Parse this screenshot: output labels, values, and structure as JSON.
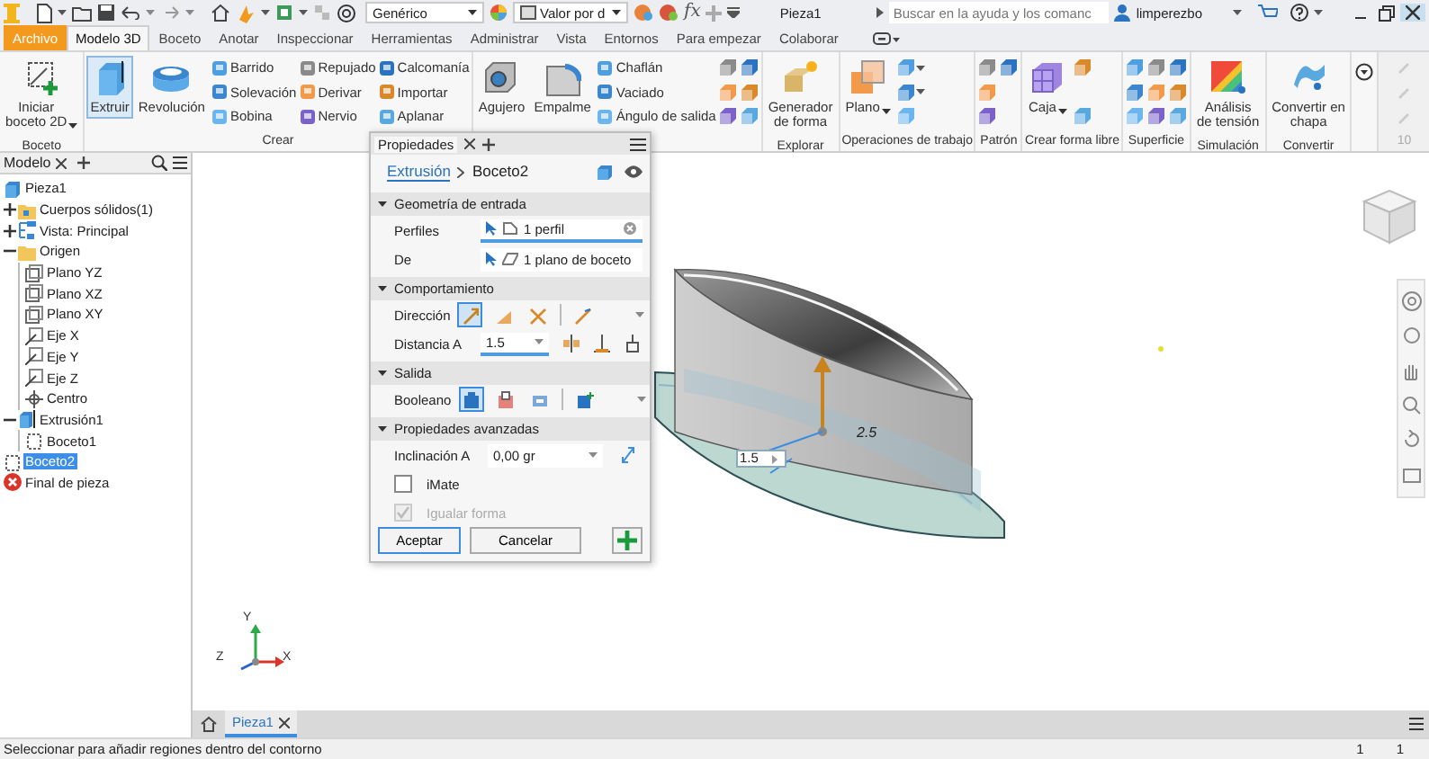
{
  "title_bar": {
    "material": "Genérico",
    "appearance": "Valor por d",
    "formula": "fx",
    "title": "Pieza1",
    "search": {
      "placeholder": "Buscar en la ayuda y los comanc"
    },
    "user": "limperezbo"
  },
  "ribbon_tabs": [
    {
      "label": "Archivo",
      "kind": "file",
      "selected": false
    },
    {
      "label": "Modelo 3D",
      "kind": "tab",
      "selected": true
    },
    {
      "label": "Boceto",
      "kind": "tab",
      "selected": false
    },
    {
      "label": "Anotar",
      "kind": "tab",
      "selected": false
    },
    {
      "label": "Inspeccionar",
      "kind": "tab",
      "selected": false
    },
    {
      "label": "Herramientas",
      "kind": "tab",
      "selected": false
    },
    {
      "label": "Administrar",
      "kind": "tab",
      "selected": false
    },
    {
      "label": "Vista",
      "kind": "tab",
      "selected": false
    },
    {
      "label": "Entornos",
      "kind": "tab",
      "selected": false
    },
    {
      "label": "Para empezar",
      "kind": "tab",
      "selected": false
    },
    {
      "label": "Colaborar",
      "kind": "tab",
      "selected": false
    }
  ],
  "ribbon_groups": [
    {
      "label": "Boceto",
      "columns": [
        [
          {
            "kind": "large",
            "label": "Iniciar\nboceto 2D",
            "dropdown": true,
            "selected": false
          }
        ]
      ]
    },
    {
      "label": "Crear",
      "columns": [
        [
          {
            "kind": "large",
            "label": "Extruir",
            "dropdown": false,
            "selected": true
          }
        ],
        [
          {
            "kind": "large",
            "label": "Revolución",
            "dropdown": false,
            "selected": false
          }
        ],
        [
          {
            "kind": "small",
            "label": "Barrido"
          },
          {
            "kind": "small",
            "label": "Solevación"
          },
          {
            "kind": "small",
            "label": "Bobina"
          }
        ],
        [
          {
            "kind": "small",
            "label": "Repujado"
          },
          {
            "kind": "small",
            "label": "Derivar"
          },
          {
            "kind": "small",
            "label": "Nervio"
          }
        ],
        [
          {
            "kind": "small",
            "label": "Calcomanía"
          },
          {
            "kind": "small",
            "label": "Importar"
          },
          {
            "kind": "small",
            "label": "Aplanar"
          }
        ]
      ]
    },
    {
      "columns": [
        [
          {
            "kind": "large",
            "label": "Agujero",
            "dropdown": false,
            "selected": false
          }
        ],
        [
          {
            "kind": "large",
            "label": "Empalme",
            "dropdown": false,
            "selected": false
          }
        ],
        [
          {
            "kind": "small",
            "label": "Chaflán"
          },
          {
            "kind": "small",
            "label": "Vaciado"
          },
          {
            "kind": "small",
            "label": "Ángulo de salida"
          }
        ],
        [
          {
            "kind": "icon",
            "dropdown": false
          },
          {
            "kind": "icon",
            "dropdown": false
          },
          {
            "kind": "icon",
            "dropdown": false
          }
        ],
        [
          {
            "kind": "icon",
            "dropdown": false
          },
          {
            "kind": "icon",
            "dropdown": false
          },
          {
            "kind": "icon",
            "dropdown": false
          }
        ]
      ]
    },
    {
      "label": "Explorar",
      "columns": [
        [
          {
            "kind": "large",
            "label": "Generador\nde forma",
            "dropdown": false,
            "selected": false
          }
        ]
      ]
    },
    {
      "label": "Operaciones de trabajo",
      "columns": [
        [
          {
            "kind": "large",
            "label": "Plano",
            "dropdown": true,
            "selected": false
          }
        ],
        [
          {
            "kind": "icon",
            "dropdown": true
          },
          {
            "kind": "icon",
            "dropdown": true
          },
          {
            "kind": "icon",
            "dropdown": false
          }
        ]
      ]
    },
    {
      "label": "Patrón",
      "columns": [
        [
          {
            "kind": "icon",
            "dropdown": false
          },
          {
            "kind": "icon",
            "dropdown": false
          },
          {
            "kind": "icon",
            "dropdown": false
          }
        ],
        [
          {
            "kind": "icon",
            "dropdown": false
          }
        ]
      ]
    },
    {
      "label": "Crear forma libre",
      "columns": [
        [
          {
            "kind": "large",
            "label": "Caja",
            "dropdown": true,
            "selected": false
          }
        ],
        [
          {
            "kind": "icon",
            "dropdown": false
          },
          {
            "kind": "icon",
            "dropdown": false
          }
        ]
      ]
    },
    {
      "label": "Superficie",
      "columns": [
        [
          {
            "kind": "icon",
            "dropdown": false
          },
          {
            "kind": "icon",
            "dropdown": false
          },
          {
            "kind": "icon",
            "dropdown": false
          }
        ],
        [
          {
            "kind": "icon",
            "dropdown": false
          },
          {
            "kind": "icon",
            "dropdown": false
          },
          {
            "kind": "icon",
            "dropdown": false
          }
        ],
        [
          {
            "kind": "icon",
            "dropdown": false
          },
          {
            "kind": "icon",
            "dropdown": false
          },
          {
            "kind": "icon",
            "dropdown": false
          }
        ]
      ]
    },
    {
      "label": "Simulación",
      "columns": [
        [
          {
            "kind": "large",
            "label": "Análisis\nde tensión",
            "dropdown": false,
            "selected": false
          }
        ]
      ]
    },
    {
      "label": "Convertir",
      "columns": [
        [
          {
            "kind": "large",
            "label": "Convertir en\nchapa",
            "dropdown": false,
            "selected": false
          }
        ]
      ]
    }
  ],
  "side_spinner": "10",
  "browser": {
    "tab": "Modelo",
    "tree": [
      {
        "label": "Pieza1",
        "kind": "part",
        "selected": false,
        "children": [
          {
            "label": "Cuerpos sólidos(1)",
            "kind": "bodies",
            "selected": false,
            "expanded": false
          },
          {
            "label": "Vista: Principal",
            "kind": "view",
            "selected": false,
            "expanded": false
          },
          {
            "label": "Origen",
            "kind": "folder",
            "selected": false,
            "expanded": true,
            "children": [
              {
                "label": "Plano YZ",
                "kind": "plane",
                "selected": false
              },
              {
                "label": "Plano XZ",
                "kind": "plane",
                "selected": false
              },
              {
                "label": "Plano XY",
                "kind": "plane",
                "selected": false
              },
              {
                "label": "Eje X",
                "kind": "axis",
                "selected": false
              },
              {
                "label": "Eje Y",
                "kind": "axis",
                "selected": false
              },
              {
                "label": "Eje Z",
                "kind": "axis",
                "selected": false
              },
              {
                "label": "Centro",
                "kind": "point",
                "selected": false
              }
            ]
          },
          {
            "label": "Extrusión1",
            "kind": "extrusion",
            "selected": false,
            "expanded": true,
            "children": [
              {
                "label": "Boceto1",
                "kind": "sketch",
                "selected": false
              }
            ]
          },
          {
            "label": "Boceto2",
            "kind": "sketch",
            "selected": true
          },
          {
            "label": "Final de pieza",
            "kind": "end",
            "selected": false
          }
        ]
      }
    ]
  },
  "properties": {
    "tab": "Propiedades",
    "breadcrumb": [
      "Extrusión",
      "Boceto2"
    ],
    "sections": [
      {
        "title": "Geometría de entrada",
        "expanded": true,
        "rows": [
          {
            "kind": "select",
            "label": "Perfiles",
            "value": "1 perfil",
            "active": true
          },
          {
            "kind": "select",
            "label": "De",
            "value": "1 plano de boceto",
            "active": false
          }
        ]
      },
      {
        "title": "Comportamiento",
        "expanded": true,
        "rows": [
          {
            "kind": "toggles",
            "label": "Dirección",
            "options": [
              {
                "selected": true
              },
              {
                "selected": false
              },
              {
                "selected": false
              },
              {
                "selected": false
              }
            ]
          },
          {
            "kind": "distance",
            "label": "Distancia A",
            "value": "1.5"
          }
        ]
      },
      {
        "title": "Salida",
        "expanded": true,
        "rows": [
          {
            "kind": "toggles",
            "label": "Booleano",
            "options": [
              {
                "selected": true
              },
              {
                "selected": false
              },
              {
                "selected": false
              },
              {
                "selected": false
              }
            ]
          }
        ]
      },
      {
        "title": "Propiedades avanzadas",
        "expanded": true,
        "rows": [
          {
            "kind": "angle",
            "label": "Inclinación A",
            "value": "0,00 gr"
          },
          {
            "kind": "checkbox",
            "label": "iMate",
            "checked": false,
            "disabled": false
          },
          {
            "kind": "checkbox",
            "label": "Igualar forma",
            "checked": true,
            "disabled": true
          }
        ]
      }
    ],
    "buttons": [
      "Aceptar",
      "Cancelar"
    ]
  },
  "canvas": {
    "dimension": "2.5",
    "distance_input": "1.5",
    "triad": [
      {
        "label": "Y"
      },
      {
        "label": "X"
      },
      {
        "label": "Z"
      }
    ]
  },
  "documents": [
    {
      "label": "Pieza1",
      "selected": true
    }
  ],
  "status_bar": {
    "message": "Seleccionar para añadir regiones dentro del contorno",
    "counts": [
      "1",
      "1"
    ]
  }
}
